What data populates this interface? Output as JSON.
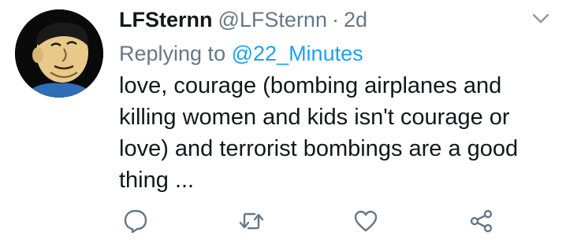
{
  "tweet": {
    "display_name": "LFSternn",
    "handle": "@LFSternn",
    "separator": "·",
    "time": "2d",
    "replying_prefix": "Replying to",
    "replying_to": "@22_Minutes",
    "text": "love, courage (bombing airplanes and killing women and kids isn't courage or love) and terrorist bombings are a good thing ..."
  },
  "icons": {
    "more": "chevron-down-icon",
    "reply": "reply-icon",
    "retweet": "retweet-icon",
    "like": "heart-icon",
    "share": "share-icon"
  },
  "colors": {
    "text": "#14171a",
    "secondary": "#657786",
    "link": "#1da1f2"
  }
}
